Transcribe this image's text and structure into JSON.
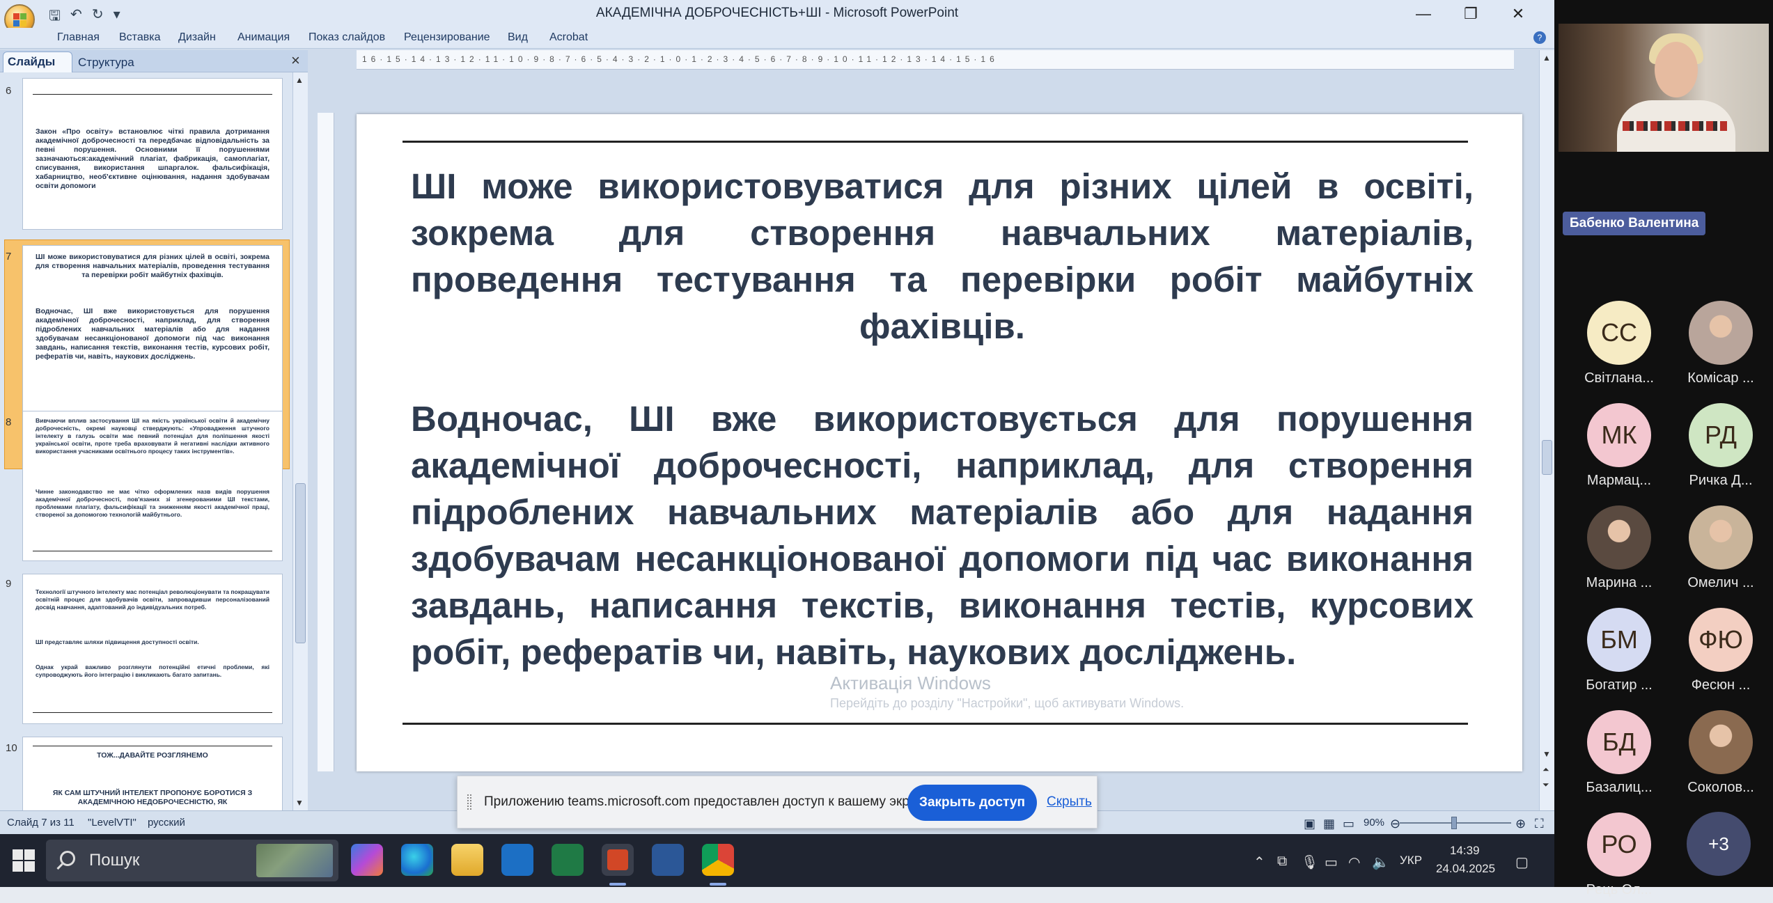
{
  "window": {
    "title": "АКАДЕМІЧНА ДОБРОЧЕСНІСТЬ+ШІ - Microsoft PowerPoint",
    "controls": [
      "—",
      "❐",
      "✕"
    ]
  },
  "ribbon_tabs": [
    "Главная",
    "Вставка",
    "Дизайн",
    "Анимация",
    "Показ слайдов",
    "Рецензирование",
    "Вид",
    "Acrobat"
  ],
  "pane_tabs": {
    "slides": "Слайды",
    "outline": "Структура"
  },
  "thumbnails": [
    {
      "number": "6",
      "text": "Закон «Про освіту» встановлює чіткі правила дотримання академічної доброчесності та передбачає відповідальність за певні порушення. Основними її порушеннями зазначаються:академічний плагіат, фабрикація, самоплагіат, списування, використання шпаргалок. фальсифікація, хабарництво, необ'єктивне оцінювання, надання здобувачам освіти допомоги"
    },
    {
      "number": "7",
      "text": "ШІ може використовуватися для різних цілей в освіті, зокрема для створення навчальних матеріалів, проведення тестування та перевірки робіт майбутніх фахівців.",
      "text2": "Водночас, ШІ вже використовується для порушення академічної доброчесності, наприклад, для створення підроблених навчальних матеріалів або для надання здобувачам несанкціонованої допомоги під час виконання завдань, написання текстів, виконання тестів, курсових робіт, рефератів чи, навіть, наукових досліджень."
    },
    {
      "number": "8",
      "text": "Вивчаючи вплив застосування ШІ на якість української освіти й академічну доброчесність, окремі науковці стверджують: «Упровадження штучного інтелекту в галузь освіти має певний потенціал для поліпшення якості української освіти, проте треба враховувати й негативні наслідки активного використання учасниками освітнього процесу таких інструментів».",
      "text2": "Чинне законодавство не має чітко оформлених назв видів порушення академічної доброчесності, пов'язаних зі згенерованими ШІ текстами, проблемами плагіату, фальсифікації та зниженням якості академічної праці, створеної за допомогою технологій майбутнього."
    },
    {
      "number": "9",
      "text": "Технології штучного інтелекту мас потенціал революціонувати та покращувати освітній процес для здобувачів освіти, запровадивши персоналізований досвід навчання, адаптований до індивідуальних потреб.",
      "text2": "ШІ представляє шляхи підвищення доступності освіти.",
      "text3": "Однак украй важливо розглянути потенційні етичні проблеми, які супроводжують його інтеграцію і викликають багато запитань."
    },
    {
      "number": "10",
      "text": "ТОЖ...ДАВАЙТЕ РОЗГЛЯНЕМО",
      "text2": "ЯК САМ ШТУЧНИЙ ІНТЕЛЕКТ ПРОПОНУЄ БОРОТИСЯ З АКАДЕМІЧНОЮ НЕДОБРОЧЕСНІСТЮ, ЯК"
    }
  ],
  "ruler": {
    "horizontal": "16·15·14·13·12·11·10·9·8·7·6·5·4·3·2·1·0·1·2·3·4·5·6·7·8·9·10·11·12·13·14·15·16"
  },
  "slide": {
    "paragraph1": "ШІ може використовуватися для різних цілей в освіті, зокрема для створення навчальних матеріалів, проведення тестування та перевірки робіт майбутніх фахівців.",
    "paragraph2": "Водночас, ШІ вже використовується для порушення академічної доброчесності, наприклад, для створення підроблених навчальних матеріалів або для надання здобувачам несанкціонованої допомоги під час виконання завдань, написання текстів, виконання тестів, курсових робіт, рефератів чи, навіть, наукових досліджень."
  },
  "activation": {
    "title": "Активація Windows",
    "subtitle": "Перейдіть до розділу \"Настройки\", щоб активувати Windows."
  },
  "statusbar": {
    "slide": "Слайд 7 из 11",
    "theme": "\"LevelVTI\"",
    "language": "русский",
    "zoom": "90%"
  },
  "share_banner": {
    "text": "Приложению teams.microsoft.com предоставлен доступ к вашему экрану.",
    "stop_label": "Закрыть доступ",
    "hide_label": "Скрыть"
  },
  "taskbar": {
    "search_placeholder": "Пошук",
    "language": "УКР",
    "time": "14:39",
    "date": "24.04.2025"
  },
  "teams": {
    "presenter_name": "Бабенко Валентина",
    "participants": [
      {
        "initials": "СС",
        "name": "Світлана...",
        "bg": "#f6ebc4",
        "photo": false
      },
      {
        "initials": "",
        "name": "Комісар ...",
        "bg": "#b9a59b",
        "photo": true
      },
      {
        "initials": "МК",
        "name": "Мармац...",
        "bg": "#f3c7d0",
        "photo": false
      },
      {
        "initials": "РД",
        "name": "Ричка Д...",
        "bg": "#cfe6c3",
        "photo": false
      },
      {
        "initials": "",
        "name": "Марина ...",
        "bg": "#5a4a40",
        "photo": true
      },
      {
        "initials": "",
        "name": "Омелич ...",
        "bg": "#c9b49a",
        "photo": true
      },
      {
        "initials": "БМ",
        "name": "Богатир ...",
        "bg": "#d5dbf2",
        "photo": false
      },
      {
        "initials": "ФЮ",
        "name": "Фесюн ...",
        "bg": "#f3cfc2",
        "photo": false
      },
      {
        "initials": "БД",
        "name": "Базалиц...",
        "bg": "#f3c7d0",
        "photo": false
      },
      {
        "initials": "",
        "name": "Соколов...",
        "bg": "#8a6a50",
        "photo": true
      },
      {
        "initials": "РО",
        "name": "Рець Ол...",
        "bg": "#f3c7d0",
        "photo": false
      }
    ],
    "more_label": "+3"
  }
}
